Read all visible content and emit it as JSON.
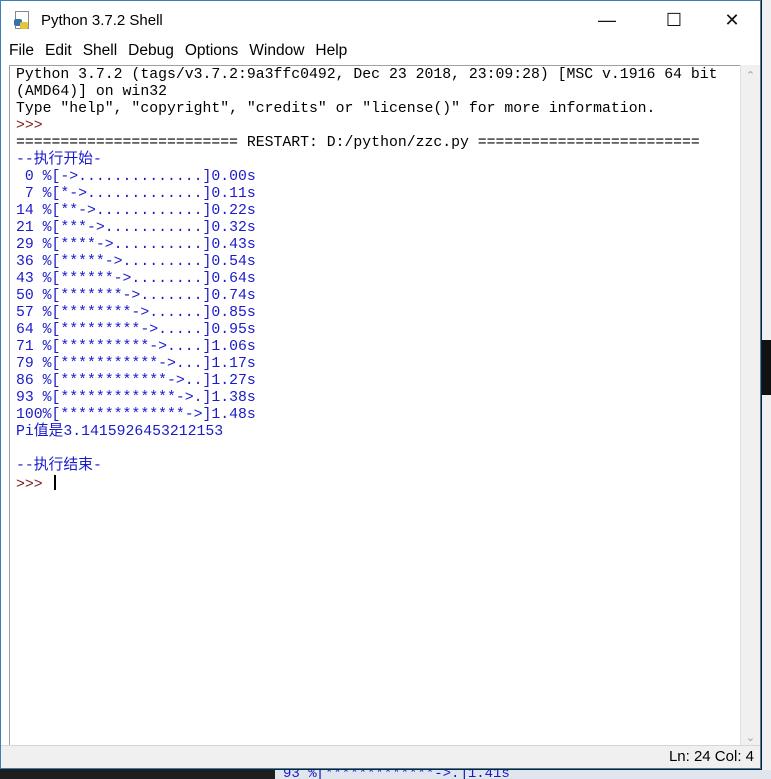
{
  "background": {
    "other_window_text": "93 %[*************->.]1.41s"
  },
  "window": {
    "title": "Python 3.7.2 Shell",
    "icon": "python-idle-icon",
    "controls": {
      "minimize": "—",
      "maximize": "☐",
      "close": "✕"
    }
  },
  "menu": [
    "File",
    "Edit",
    "Shell",
    "Debug",
    "Options",
    "Window",
    "Help"
  ],
  "shell": {
    "lines": [
      {
        "text": "Python 3.7.2 (tags/v3.7.2:9a3ffc0492, Dec 23 2018, 23:09:28) [MSC v.1916 64 bit",
        "kind": "banner"
      },
      {
        "text": "(AMD64)] on win32",
        "kind": "banner"
      },
      {
        "text": "Type \"help\", \"copyright\", \"credits\" or \"license()\" for more information.",
        "kind": "banner"
      },
      {
        "text": ">>> ",
        "kind": "prompt"
      },
      {
        "text": "========================= RESTART: D:/python/zzc.py =========================",
        "kind": "banner"
      },
      {
        "text": "--执行开始-",
        "kind": "stdout"
      },
      {
        "text": " 0 %[->..............]0.00s",
        "kind": "stdout"
      },
      {
        "text": " 7 %[*->.............]0.11s",
        "kind": "stdout"
      },
      {
        "text": "14 %[**->............]0.22s",
        "kind": "stdout"
      },
      {
        "text": "21 %[***->...........]0.32s",
        "kind": "stdout"
      },
      {
        "text": "29 %[****->..........]0.43s",
        "kind": "stdout"
      },
      {
        "text": "36 %[*****->.........]0.54s",
        "kind": "stdout"
      },
      {
        "text": "43 %[******->........]0.64s",
        "kind": "stdout"
      },
      {
        "text": "50 %[*******->.......]0.74s",
        "kind": "stdout"
      },
      {
        "text": "57 %[********->......]0.85s",
        "kind": "stdout"
      },
      {
        "text": "64 %[*********->.....]0.95s",
        "kind": "stdout"
      },
      {
        "text": "71 %[**********->....]1.06s",
        "kind": "stdout"
      },
      {
        "text": "79 %[***********->...]1.17s",
        "kind": "stdout"
      },
      {
        "text": "86 %[************->..]1.27s",
        "kind": "stdout"
      },
      {
        "text": "93 %[*************->.]1.38s",
        "kind": "stdout"
      },
      {
        "text": "100%[**************->]1.48s",
        "kind": "stdout"
      },
      {
        "text": "Pi值是3.1415926453212153",
        "kind": "stdout"
      },
      {
        "text": "",
        "kind": "stdout"
      },
      {
        "text": "--执行结束-",
        "kind": "stdout"
      }
    ],
    "final_prompt": ">>> "
  },
  "status": {
    "position": "Ln: 24  Col: 4"
  }
}
